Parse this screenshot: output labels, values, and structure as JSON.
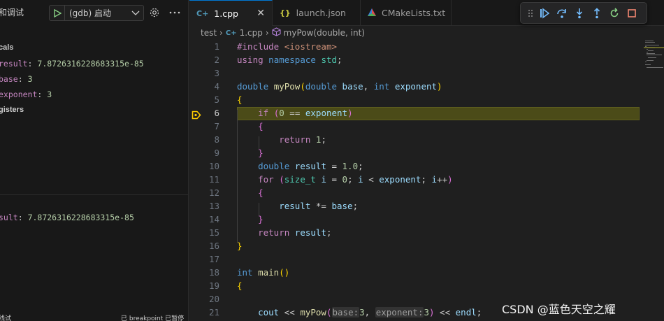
{
  "sidebar": {
    "title": "和调试",
    "launch_config": "(gdb) 启动",
    "sections": {
      "locals": "cals",
      "registers": "gisters"
    },
    "locals": [
      {
        "name": "result",
        "display_name": "result",
        "value": "7.8726316228683315e-85"
      },
      {
        "name": "base",
        "display_name": "base",
        "value": "3"
      },
      {
        "name": "exponent",
        "display_name": "exponent",
        "value": "3"
      }
    ],
    "watch": {
      "name": "sult",
      "value": "7.8726316228683315e-85"
    },
    "footer_left": "线试",
    "footer_right": "已 breakpoint 已暂停"
  },
  "tabs": [
    {
      "label": "1.cpp",
      "icon": "cpp-icon",
      "active": true,
      "closable": true
    },
    {
      "label": "launch.json",
      "icon": "json-braces-icon",
      "active": false
    },
    {
      "label": "CMakeLists.txt",
      "icon": "cmake-triangle-icon",
      "active": false
    }
  ],
  "debug_toolbar": [
    "drag-handle-icon",
    "continue-icon",
    "step-over-icon",
    "step-into-icon",
    "step-out-icon",
    "restart-icon",
    "stop-icon"
  ],
  "breadcrumb": {
    "folder": "test",
    "file": "1.cpp",
    "symbol": "myPow(double, int)"
  },
  "editor": {
    "current_line": 6,
    "line_numbers": [
      "1",
      "2",
      "3",
      "4",
      "5",
      "6",
      "7",
      "8",
      "9",
      "10",
      "11",
      "12",
      "13",
      "14",
      "15",
      "16",
      "17",
      "18",
      "19",
      "20",
      "21"
    ],
    "inlay_hints": {
      "base": "base:",
      "exponent": "exponent:"
    }
  },
  "watermark": "CSDN @蓝色天空之耀",
  "colors": {
    "accent": "#0078d4",
    "current_line": "#4b4b18",
    "breakpoint_arrow": "#ffcc00"
  }
}
